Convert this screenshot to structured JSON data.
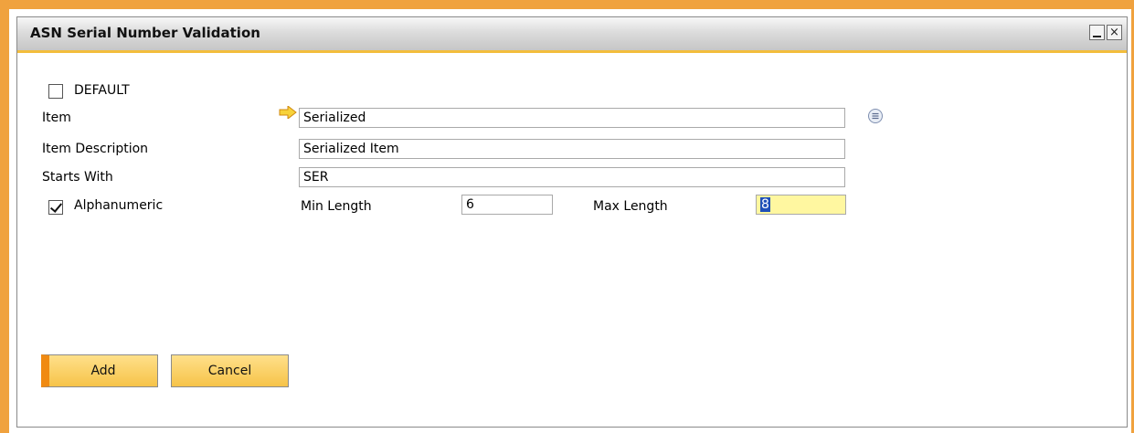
{
  "window": {
    "title": "ASN Serial Number Validation",
    "minimize": "_",
    "close": "×"
  },
  "form": {
    "default_checkbox": {
      "label": "DEFAULT",
      "checked": false
    },
    "item": {
      "label": "Item",
      "value": "Serialized"
    },
    "item_description": {
      "label": "Item Description",
      "value": "Serialized Item"
    },
    "starts_with": {
      "label": "Starts With",
      "value": "SER"
    },
    "alphanumeric": {
      "label": "Alphanumeric",
      "checked": true
    },
    "min_length": {
      "label": "Min Length",
      "value": "6"
    },
    "max_length": {
      "label": "Max Length",
      "value": "8"
    }
  },
  "buttons": {
    "add": "Add",
    "cancel": "Cancel"
  },
  "icons": {
    "link_arrow": "link-arrow-icon",
    "choose_list": "list-icon"
  },
  "colors": {
    "frame_orange": "#f0a23e",
    "title_underline": "#f3bd3c",
    "button_gold": "#f6c349",
    "active_field": "#fff7a0"
  }
}
